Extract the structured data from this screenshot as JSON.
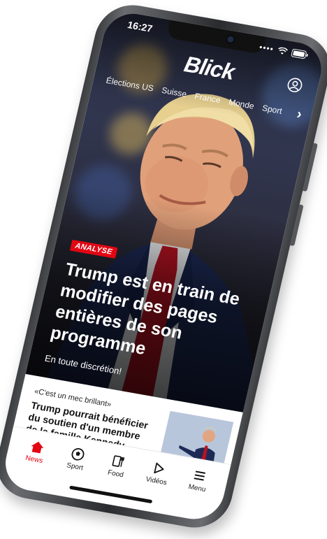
{
  "status_bar": {
    "time": "16:27"
  },
  "app": {
    "brand": "Blick"
  },
  "nav": {
    "items": [
      "Élections US",
      "Suisse",
      "France",
      "Monde",
      "Sport"
    ]
  },
  "hero": {
    "badge": "ANALYSE",
    "headline": "Trump est en train de modifier des pages entières de son programme",
    "subhead": "En toute discrétion!"
  },
  "article": {
    "kicker": "«C'est un mec brillant»",
    "title": "Trump pourrait bénéficier du soutien d'un membre de la famille Kennedy"
  },
  "tabbar": {
    "tabs": [
      {
        "label": "News",
        "icon": "home-icon",
        "active": true
      },
      {
        "label": "Sport",
        "icon": "soccer-ball-icon",
        "active": false
      },
      {
        "label": "Food",
        "icon": "food-icon",
        "active": false
      },
      {
        "label": "Vidéos",
        "icon": "play-icon",
        "active": false
      },
      {
        "label": "Menu",
        "icon": "menu-icon",
        "active": false
      }
    ]
  },
  "colors": {
    "accent": "#e20613",
    "tab_active": "#e20613"
  }
}
